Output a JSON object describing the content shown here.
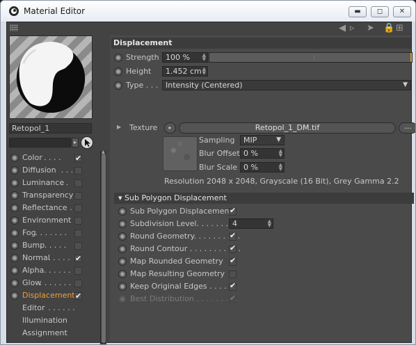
{
  "window": {
    "title": "Material Editor",
    "buttons": [
      "minimize",
      "maximize",
      "close"
    ]
  },
  "toolbar": {
    "icons": [
      "grip-icon",
      "back-arrow-icon",
      "forward-arrow-icon",
      "lock-icon",
      "new-window-icon"
    ]
  },
  "material": {
    "name": "Retopol_1"
  },
  "channels": [
    {
      "label": "Color",
      "dots": " . . . . ",
      "checked": true,
      "active": false
    },
    {
      "label": "Diffusion",
      "dots": " . . . . ",
      "checked": false,
      "active": false
    },
    {
      "label": "Luminance",
      "dots": " . . ",
      "checked": false,
      "active": false
    },
    {
      "label": "Transparency",
      "dots": "",
      "checked": false,
      "active": false
    },
    {
      "label": "Reflectance",
      "dots": " . . ",
      "checked": false,
      "active": false
    },
    {
      "label": "Environment",
      "dots": "",
      "checked": false,
      "active": false
    },
    {
      "label": "Fog",
      "dots": " . . . . . . . ",
      "checked": false,
      "active": false
    },
    {
      "label": "Bump",
      "dots": " . . . . . . ",
      "checked": false,
      "active": false
    },
    {
      "label": "Normal",
      "dots": " . . . . . ",
      "checked": true,
      "active": false
    },
    {
      "label": "Alpha",
      "dots": " . . . . . . ",
      "checked": false,
      "active": false
    },
    {
      "label": "Glow",
      "dots": " . . . . . . . ",
      "checked": false,
      "active": false
    },
    {
      "label": "Displacement",
      "dots": "",
      "checked": true,
      "active": true
    },
    {
      "label": "Editor",
      "dots": " . . . . . . ",
      "checked": null,
      "active": false
    },
    {
      "label": "Illumination",
      "dots": "",
      "checked": null,
      "active": false
    },
    {
      "label": "Assignment",
      "dots": "",
      "checked": null,
      "active": false
    }
  ],
  "displacement": {
    "section_title": "Displacement",
    "strength_label": "Strength",
    "strength_value": "100 %",
    "strength_fraction": 1.0,
    "height_label": "Height",
    "height_value": "1.452 cm",
    "type_label": "Type . . .",
    "type_value": "Intensity (Centered)",
    "texture_label": "Texture",
    "texture_file": "Retopol_1_DM.tif",
    "texture_more": "...",
    "sampling_label": "Sampling",
    "sampling_value": "MIP",
    "blur_offset_label": "Blur Offset",
    "blur_offset_value": "0 %",
    "blur_scale_label": "Blur Scale",
    "blur_scale_value": "0 %",
    "resolution_text": "Resolution 2048 x 2048, Grayscale (16 Bit), Grey Gamma 2.2"
  },
  "sub_polygon": {
    "section_title": "Sub Polygon Displacement",
    "rows": [
      {
        "label": "Sub Polygon Displacement",
        "checked": true,
        "dim": false
      },
      {
        "label": "Subdivision Level. . . . . . . . . .",
        "value": "4",
        "dim": false
      },
      {
        "label": "Round Geometry. . . . . . . . . .",
        "checked": true,
        "dim": false
      },
      {
        "label": "Round Contour . . . . . . . . . . .",
        "checked": true,
        "dim": false
      },
      {
        "label": "Map Rounded Geometry",
        "checked": true,
        "dim": false
      },
      {
        "label": "Map Resulting Geometry",
        "checked": false,
        "dim": false
      },
      {
        "label": "Keep Original Edges . . . . .",
        "checked": true,
        "dim": false
      },
      {
        "label": "Best Distribution . . . . . . . . .",
        "checked": true,
        "dim": true
      }
    ]
  }
}
